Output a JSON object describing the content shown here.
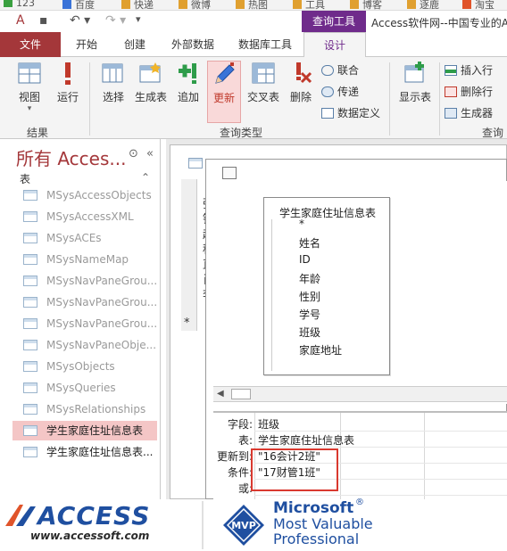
{
  "bookmarks": [
    {
      "label": "123",
      "color": "#e0a030"
    },
    {
      "label": "百度",
      "color": "#3a73d8"
    },
    {
      "label": "快递",
      "color": "#e0a030"
    },
    {
      "label": "微博",
      "color": "#e0a030"
    },
    {
      "label": "热图",
      "color": "#e0a030"
    },
    {
      "label": "工具",
      "color": "#e0a030"
    },
    {
      "label": "博客",
      "color": "#e0a030"
    },
    {
      "label": "逐鹿",
      "color": "#e0a030"
    },
    {
      "label": "淘宝",
      "color": "#e0542a"
    }
  ],
  "titlebar": {
    "context_tab": "查询工具",
    "window_title": "Access软件网--中国专业的A"
  },
  "tabs": [
    "文件",
    "开始",
    "创建",
    "外部数据",
    "数据库工具",
    "设计"
  ],
  "ribbon": {
    "results": {
      "view": "视图",
      "run": "运行",
      "group": "结果"
    },
    "query_type": {
      "select": "选择",
      "make_table": "生成表",
      "append": "追加",
      "update": "更新",
      "crosstab": "交叉表",
      "delete": "删除",
      "union": "联合",
      "passthrough": "传递",
      "data_definition": "数据定义",
      "group": "查询类型"
    },
    "setup": {
      "show_table": "显示表",
      "insert_row": "插入行",
      "delete_row": "删除行",
      "builder": "生成器",
      "group": "查询"
    }
  },
  "nav": {
    "title": "所有 Acces...",
    "section": "表",
    "items": [
      {
        "label": "MSysAccessObjects",
        "state": "hidden"
      },
      {
        "label": "MSysAccessXML",
        "state": "hidden"
      },
      {
        "label": "MSysACEs",
        "state": "hidden"
      },
      {
        "label": "MSysNameMap",
        "state": "hidden"
      },
      {
        "label": "MSysNavPaneGrou...",
        "state": "hidden"
      },
      {
        "label": "MSysNavPaneGrou...",
        "state": "hidden"
      },
      {
        "label": "MSysNavPaneGrou...",
        "state": "hidden"
      },
      {
        "label": "MSysNavPaneObje...",
        "state": "hidden"
      },
      {
        "label": "MSysObjects",
        "state": "hidden"
      },
      {
        "label": "MSysQueries",
        "state": "hidden"
      },
      {
        "label": "MSysRelationships",
        "state": "hidden"
      },
      {
        "label": "学生家庭住址信息表",
        "state": "selected"
      },
      {
        "label": "学生家庭住址信息表...",
        "state": "normal"
      }
    ]
  },
  "datasheet": {
    "col_chars": [
      "張",
      "钟",
      "赵",
      "程",
      "直",
      "肖",
      "李"
    ],
    "new_row_marker": "*"
  },
  "query_design": {
    "table": {
      "title": "学生家庭住址信息表",
      "fields": [
        "*",
        "姓名",
        "ID",
        "年龄",
        "性别",
        "学号",
        "班级",
        "家庭地址"
      ]
    },
    "grid": {
      "labels": [
        "字段:",
        "表:",
        "更新到:",
        "条件:",
        "或:"
      ],
      "values": [
        "班级",
        "学生家庭住址信息表",
        "\"16会计2班\"",
        "\"17财管1班\"",
        ""
      ]
    }
  },
  "banner": {
    "access_logo": "ACCESS",
    "access_site": "www.accessoft.com",
    "mvp_badge": "MVP",
    "mvp_line1": "Microsoft",
    "mvp_line2": "Most Valuable",
    "mvp_line3": "Professional",
    "registered": "®"
  }
}
